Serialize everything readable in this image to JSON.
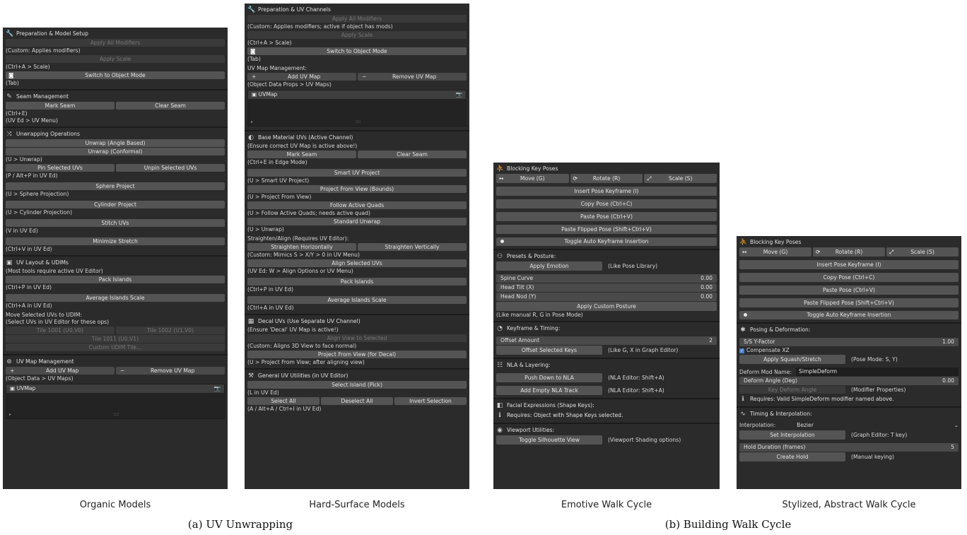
{
  "p1": {
    "s1": {
      "title": "Preparation & Model Setup",
      "apply_mod": "Apply All Modifiers",
      "t1": "(Custom: Applies modifiers)",
      "apply_scale": "Apply Scale",
      "t2": "(Ctrl+A > Scale)",
      "switch": "Switch to Object Mode",
      "t3": "(Tab)"
    },
    "s2": {
      "title": "Seam Management",
      "mark": "Mark Seam",
      "clear": "Clear Seam",
      "t1": "(Ctrl+E)",
      "t2": "(UV Ed > UV Menu)"
    },
    "s3": {
      "title": "Unwrapping Operations",
      "b1": "Unwrap (Angle Based)",
      "b2": "Unwrap (Conformal)",
      "t1": "(U > Unwrap)",
      "pin": "Pin Selected UVs",
      "unpin": "Unpin Selected UVs",
      "t2": "(P / Alt+P in UV Ed)",
      "sphere": "Sphere Project",
      "t3": "(U > Sphere Projection)",
      "cyl": "Cylinder Project",
      "t4": "(U > Cylinder Projection)",
      "stitch": "Stitch UVs",
      "t5": "(V in UV Ed)",
      "min": "Minimize Stretch",
      "t6": "(Ctrl+V in UV Ed)"
    },
    "s4": {
      "title": "UV Layout & UDIMs",
      "t0": "(Most tools require active UV Editor)",
      "pack": "Pack Islands",
      "t1": "(Ctrl+P in UV Ed)",
      "avg": "Average Islands Scale",
      "t2": "(Ctrl+A in UV Ed)",
      "t3": "Move Selected UVs to UDIM:",
      "t4": "(Select UVs in UV Editor for these ops)",
      "tile1001": "Tile 1001 (U0,V0)",
      "tile1002": "Tile 1002 (U1,V0)",
      "tile1011": "Tile 1011 (U0,V1)",
      "custom": "Custom UDIM Tile..."
    },
    "s5": {
      "title": "UV Map Management",
      "add": "Add UV Map",
      "remove": "Remove UV Map",
      "plus": "+",
      "minus": "−",
      "t1": "(Object Data > UV Maps)",
      "uvmap": "UVMap",
      "dots": "::::"
    }
  },
  "p2": {
    "s1": {
      "title": "Preparation & UV Channels",
      "apply_mod": "Apply All Modifiers",
      "t1": "(Custom: Applies modifiers; active if object has mods)",
      "apply_scale": "Apply Scale",
      "t2": "(Ctrl+A > Scale)",
      "switch": "Switch to Object Mode",
      "t3": "(Tab)",
      "t4": "UV Map Management:",
      "add": "Add UV Map",
      "remove": "Remove UV Map",
      "plus": "+",
      "minus": "−",
      "t5": "(Object Data Props > UV Maps)",
      "uvmap": "UVMap",
      "dots": "::::"
    },
    "s2": {
      "title": "Base Material UVs (Active Channel)",
      "t1": "(Ensure correct UV Map is active above!)",
      "mark": "Mark Seam",
      "clear": "Clear Seam",
      "t2": "(Ctrl+E in Edge Mode)",
      "smart": "Smart UV Project",
      "t3": "(U > Smart UV Project)",
      "pfv": "Project From View (Bounds)",
      "t4": "(U > Project From View)",
      "faq": "Follow Active Quads",
      "t5": "(U > Follow Active Quads; needs active quad)",
      "std": "Standard Unwrap",
      "t6": "(U > Unwrap)",
      "t7": "Straighten/Align (Requires UV Editor):",
      "sh": "Straighten Horizontally",
      "sv": "Straighten Vertically",
      "t8": "(Custom: Mimics S > X/Y > 0 in UV Menu)",
      "align": "Align Selected UVs",
      "t9": "(UV Ed: W > Align Options or UV Menu)",
      "pack": "Pack Islands",
      "t10": "(Ctrl+P in UV Ed)",
      "avg": "Average Islands Scale",
      "t11": "(Ctrl+A in UV Ed)"
    },
    "s3": {
      "title": "Decal UVs (Use Separate UV Channel)",
      "t1": "(Ensure 'Decal' UV Map is active!)",
      "atv": "Align View to Selected",
      "t2": "(Custom: Aligns 3D View to face normal)",
      "pfv": "Project From View (for Decal)",
      "t3": "(U > Project From View; after aligning view)"
    },
    "s4": {
      "title": "General UV Utilities (in UV Editor)",
      "sip": "Select Island (Pick)",
      "t1": "(L in UV Ed)",
      "sa": "Select All",
      "da": "Deselect All",
      "inv": "Invert Selection",
      "t2": "(A / Alt+A / Ctrl+I in UV Ed)"
    }
  },
  "p3": {
    "s1": {
      "title": "Blocking Key Poses",
      "move": "Move (G)",
      "rotate": "Rotate (R)",
      "scale": "Scale (S)",
      "insert": "Insert Pose Keyframe (I)",
      "copy": "Copy Pose (Ctrl+C)",
      "paste": "Paste Pose (Ctrl+V)",
      "flip": "Paste Flipped Pose (Shift+Ctrl+V)",
      "toggle": "Toggle Auto Keyframe Insertion"
    },
    "s2": {
      "title": "Presets & Posture:",
      "emotion": "Apply Emotion",
      "emotion_note": "(Like Pose Library)",
      "spine": "Spine Curve",
      "spine_v": "0.00",
      "tilt": "Head Tilt (X)",
      "tilt_v": "0.00",
      "nod": "Head Nod (Y)",
      "nod_v": "0.00",
      "custom": "Apply Custom Posture",
      "t1": "(Like manual R, G in Pose Mode)"
    },
    "s3": {
      "title": "Keyframe & Timing:",
      "offset": "Offset Amount",
      "offset_v": "2",
      "osk": "Offset Selected Keys",
      "osk_note": "(Like G, X in Graph Editor)"
    },
    "s4": {
      "title": "NLA & Layering:",
      "push": "Push Down to NLA",
      "push_note": "(NLA Editor: Shift+A)",
      "empty": "Add Empty NLA Track",
      "empty_note": "(NLA Editor: Shift+A)"
    },
    "s5": {
      "title": "Facial Expressions (Shape Keys):",
      "req": "Requires: Object with Shape Keys selected."
    },
    "s6": {
      "title": "Viewport Utilities:",
      "sil": "Toggle Silhouette View",
      "sil_note": "(Viewport Shading options)"
    }
  },
  "p4": {
    "s1": {
      "title": "Blocking Key Poses",
      "move": "Move (G)",
      "rotate": "Rotate (R)",
      "scale": "Scale (S)",
      "insert": "Insert Pose Keyframe (I)",
      "copy": "Copy Pose (Ctrl+C)",
      "paste": "Paste Pose (Ctrl+V)",
      "flip": "Paste Flipped Pose (Shift+Ctrl+V)",
      "toggle": "Toggle Auto Keyframe Insertion"
    },
    "s2": {
      "title": "Posing & Deformation:",
      "ssy": "S/S Y-Factor",
      "ssy_v": "1.00",
      "cxz": "Compensate XZ",
      "squash": "Apply Squash/Stretch",
      "squash_note": "(Pose Mode: S, Y)",
      "dmn": "Deform Mod Name:",
      "dmn_v": "SimpleDeform",
      "da": "Deform Angle (Deg)",
      "da_v": "0.00",
      "kda": "Key Deform Angle",
      "kda_note": "(Modifier Properties)",
      "req": "Requires: Valid SimpleDeform modifier named above."
    },
    "s3": {
      "title": "Timing & Interpolation:",
      "interp": "Interpolation:",
      "interp_v": "Bezier",
      "set": "Set Interpolation",
      "set_note": "(Graph Editor: T key)",
      "hold": "Hold Duration (frames)",
      "hold_v": "5",
      "create": "Create Hold",
      "create_note": "(Manual keying)"
    }
  },
  "captions": {
    "c1": "Organic Models",
    "c2": "Hard-Surface Models",
    "c3": "Emotive Walk Cycle",
    "c4": "Stylized, Abstract Walk Cycle",
    "fa": "(a) UV Unwrapping",
    "fb": "(b) Building Walk Cycle"
  }
}
